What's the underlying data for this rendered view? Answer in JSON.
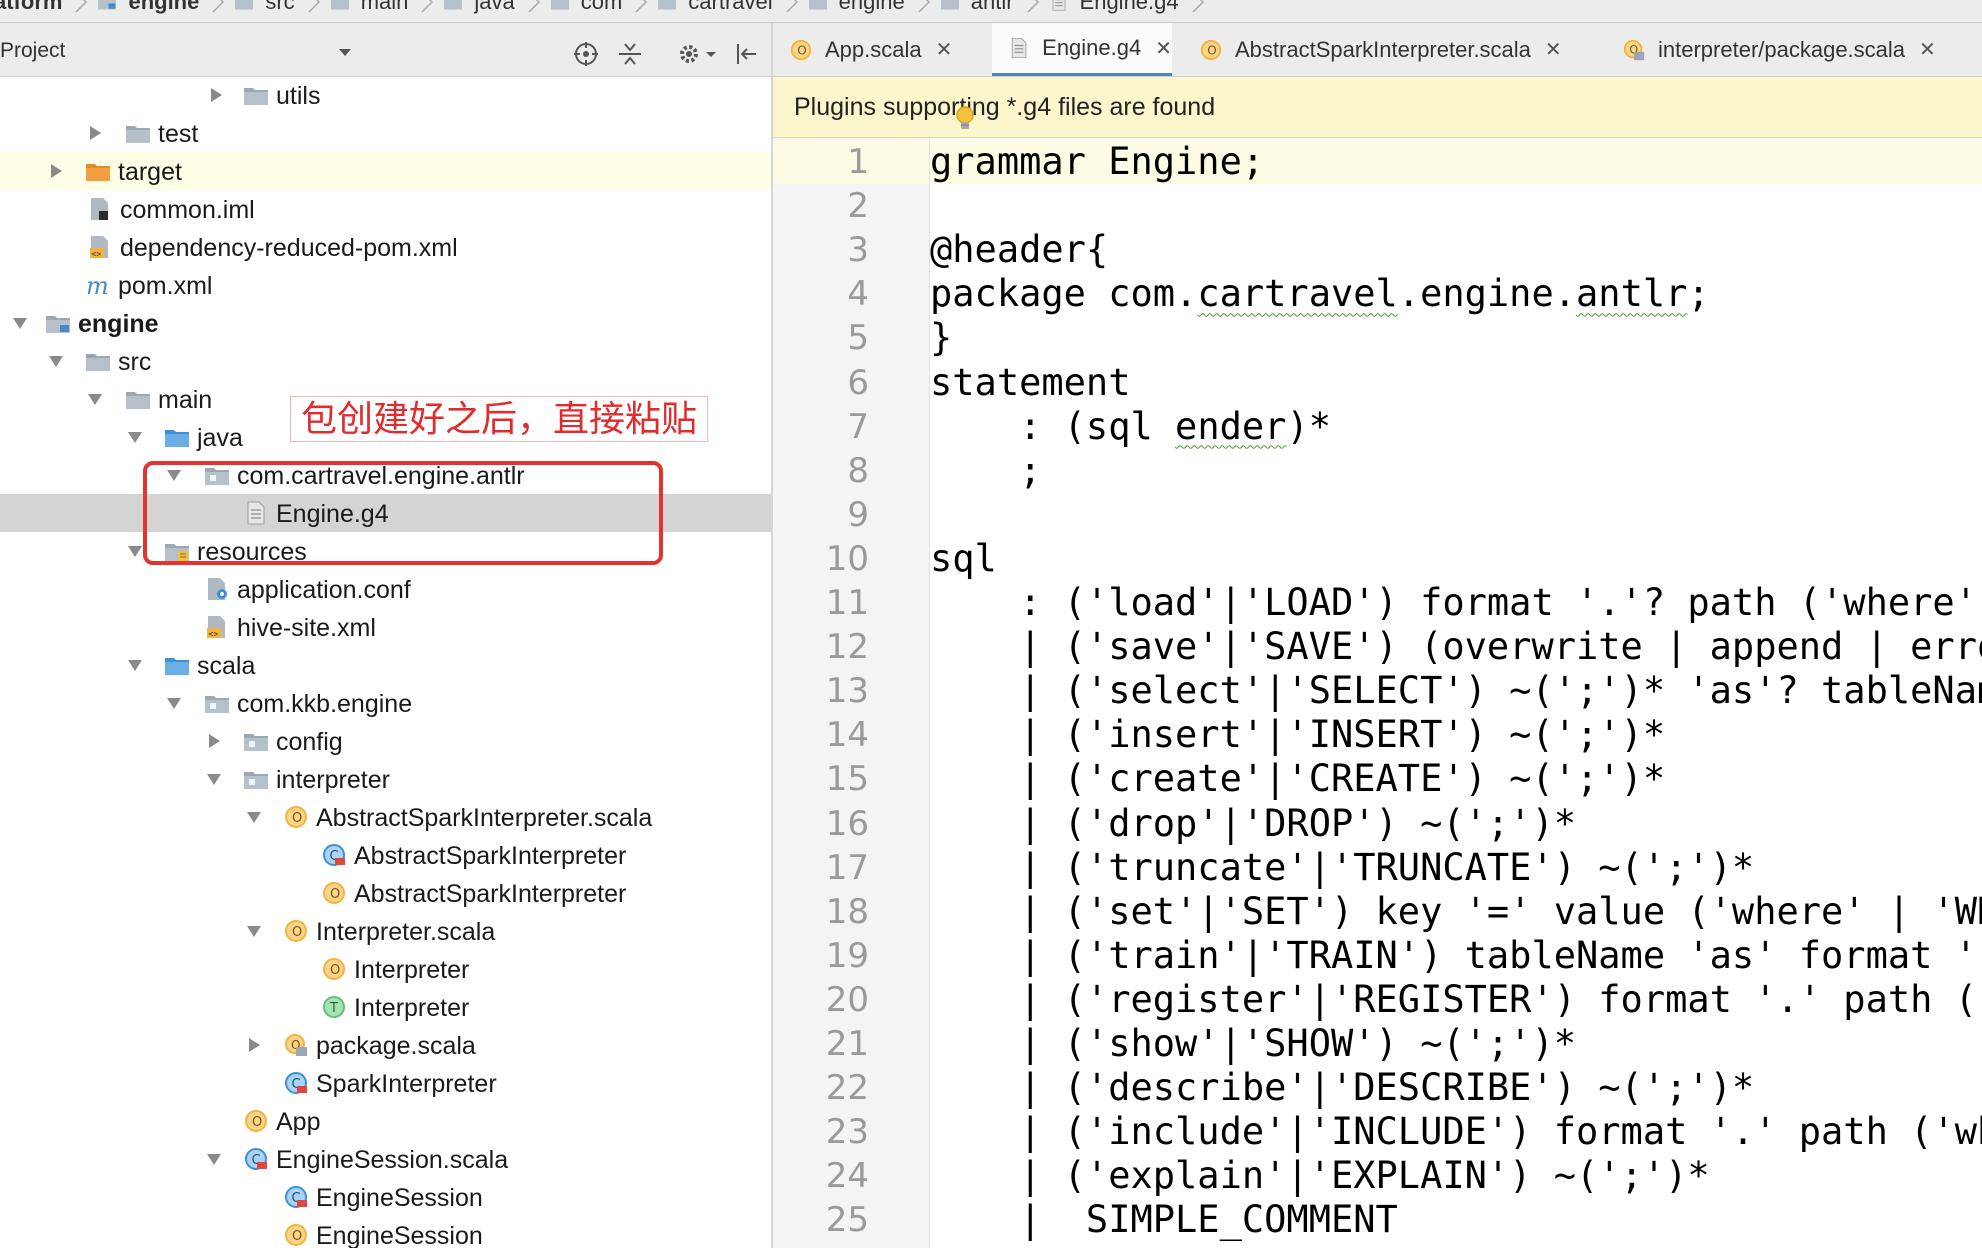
{
  "breadcrumb": [
    "atform",
    "engine",
    "src",
    "main",
    "java",
    "com",
    "cartravel",
    "engine",
    "antlr",
    "Engine.g4"
  ],
  "project_panel": {
    "title": "Project",
    "annotation_text": "包创建好之后，直接粘贴",
    "tree": [
      {
        "label": "utils",
        "icon": "folder-icon",
        "arrow": "collapsed"
      },
      {
        "label": "test",
        "icon": "folder-icon",
        "arrow": "collapsed"
      },
      {
        "label": "target",
        "icon": "orange-folder-icon",
        "arrow": "collapsed",
        "highlight": true
      },
      {
        "label": "common.iml",
        "icon": "iml-file-icon"
      },
      {
        "label": "dependency-reduced-pom.xml",
        "icon": "xml-file-icon"
      },
      {
        "label": "pom.xml",
        "icon": "maven-m-icon"
      },
      {
        "label": "engine",
        "icon": "module-folder-icon",
        "arrow": "expanded",
        "bold": true
      },
      {
        "label": "src",
        "icon": "folder-icon",
        "arrow": "expanded"
      },
      {
        "label": "main",
        "icon": "folder-icon",
        "arrow": "expanded"
      },
      {
        "label": "java",
        "icon": "source-folder-icon",
        "arrow": "expanded"
      },
      {
        "label": "com.cartravel.engine.antlr",
        "icon": "package-icon",
        "arrow": "expanded"
      },
      {
        "label": "Engine.g4",
        "icon": "text-file-icon",
        "selected": true
      },
      {
        "label": "resources",
        "icon": "resources-folder-icon",
        "arrow": "expanded"
      },
      {
        "label": "application.conf",
        "icon": "conf-file-icon"
      },
      {
        "label": "hive-site.xml",
        "icon": "xml-file-icon"
      },
      {
        "label": "scala",
        "icon": "source-folder-icon",
        "arrow": "expanded"
      },
      {
        "label": "com.kkb.engine",
        "icon": "package-icon",
        "arrow": "expanded"
      },
      {
        "label": "config",
        "icon": "package-icon",
        "arrow": "collapsed"
      },
      {
        "label": "interpreter",
        "icon": "package-icon",
        "arrow": "expanded"
      },
      {
        "label": "AbstractSparkInterpreter.scala",
        "icon": "scala-object-icon",
        "arrow": "expanded"
      },
      {
        "label": "AbstractSparkInterpreter",
        "icon": "scala-class-icon"
      },
      {
        "label": "AbstractSparkInterpreter",
        "icon": "scala-object-icon"
      },
      {
        "label": "Interpreter.scala",
        "icon": "scala-object-icon",
        "arrow": "expanded"
      },
      {
        "label": "Interpreter",
        "icon": "scala-object-icon"
      },
      {
        "label": "Interpreter",
        "icon": "scala-trait-icon"
      },
      {
        "label": "package.scala",
        "icon": "scala-package-object-icon",
        "arrow": "collapsed"
      },
      {
        "label": "SparkInterpreter",
        "icon": "scala-class-icon"
      },
      {
        "label": "App",
        "icon": "scala-object-icon"
      },
      {
        "label": "EngineSession.scala",
        "icon": "scala-class-icon",
        "arrow": "expanded"
      },
      {
        "label": "EngineSession",
        "icon": "scala-class-icon"
      },
      {
        "label": "EngineSession",
        "icon": "scala-object-icon"
      }
    ]
  },
  "editor": {
    "tabs": [
      {
        "label": "App.scala",
        "icon": "scala-object-icon",
        "active": false
      },
      {
        "label": "Engine.g4",
        "icon": "text-file-icon",
        "active": true
      },
      {
        "label": "AbstractSparkInterpreter.scala",
        "icon": "scala-object-icon",
        "active": false
      },
      {
        "label": "interpreter/package.scala",
        "icon": "scala-package-object-icon",
        "active": false
      }
    ],
    "plugin_banner": "Plugins supporting *.g4 files are found",
    "lines": [
      {
        "n": "1",
        "text": "grammar Engine;"
      },
      {
        "n": "2",
        "text": ""
      },
      {
        "n": "3",
        "text": "@header{"
      },
      {
        "n": "4",
        "text": "package com.cartravel.engine.antlr;"
      },
      {
        "n": "5",
        "text": "}"
      },
      {
        "n": "6",
        "text": "statement"
      },
      {
        "n": "7",
        "text": "    : (sql ender)*"
      },
      {
        "n": "8",
        "text": "    ;"
      },
      {
        "n": "9",
        "text": ""
      },
      {
        "n": "10",
        "text": "sql"
      },
      {
        "n": "11",
        "text": "    : ('load'|'LOAD') format '.'? path ('where'"
      },
      {
        "n": "12",
        "text": "    | ('save'|'SAVE') (overwrite | append | erro"
      },
      {
        "n": "13",
        "text": "    | ('select'|'SELECT') ~(';')* 'as'? tableNam"
      },
      {
        "n": "14",
        "text": "    | ('insert'|'INSERT') ~(';')*"
      },
      {
        "n": "15",
        "text": "    | ('create'|'CREATE') ~(';')*"
      },
      {
        "n": "16",
        "text": "    | ('drop'|'DROP') ~(';')*"
      },
      {
        "n": "17",
        "text": "    | ('truncate'|'TRUNCATE') ~(';')*"
      },
      {
        "n": "18",
        "text": "    | ('set'|'SET') key '=' value ('where' | 'WH"
      },
      {
        "n": "19",
        "text": "    | ('train'|'TRAIN') tableName 'as' format '"
      },
      {
        "n": "20",
        "text": "    | ('register'|'REGISTER') format '.' path ("
      },
      {
        "n": "21",
        "text": "    | ('show'|'SHOW') ~(';')*"
      },
      {
        "n": "22",
        "text": "    | ('describe'|'DESCRIBE') ~(';')*"
      },
      {
        "n": "23",
        "text": "    | ('include'|'INCLUDE') format '.' path ('wh"
      },
      {
        "n": "24",
        "text": "    | ('explain'|'EXPLAIN') ~(';')*"
      },
      {
        "n": "25",
        "text": "    |  SIMPLE_COMMENT"
      }
    ]
  },
  "colors": {
    "folder": "#9aa7b4",
    "orange_folder": "#f0a040",
    "scala_object": "#f2b43c",
    "scala_class": "#3d8fd6",
    "scala_trait": "#62c078",
    "annotation_red": "#e3332f",
    "banner_bg": "#fbf6cb",
    "active_tab_underline": "#4a88c7"
  }
}
